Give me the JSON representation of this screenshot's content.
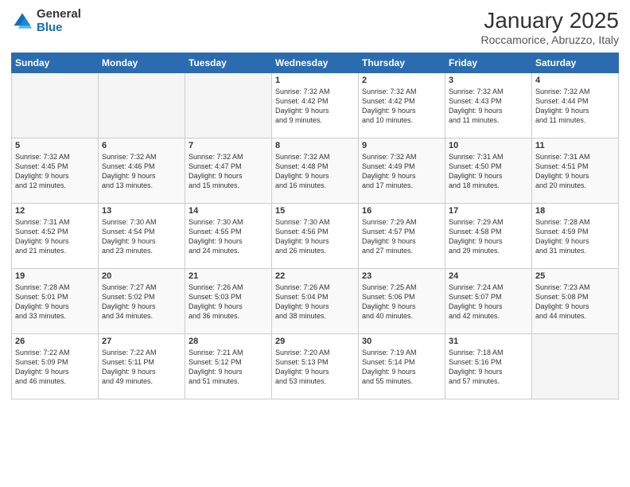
{
  "logo": {
    "general": "General",
    "blue": "Blue"
  },
  "title": "January 2025",
  "location": "Roccamorice, Abruzzo, Italy",
  "weekdays": [
    "Sunday",
    "Monday",
    "Tuesday",
    "Wednesday",
    "Thursday",
    "Friday",
    "Saturday"
  ],
  "weeks": [
    [
      {
        "day": "",
        "info": ""
      },
      {
        "day": "",
        "info": ""
      },
      {
        "day": "",
        "info": ""
      },
      {
        "day": "1",
        "info": "Sunrise: 7:32 AM\nSunset: 4:42 PM\nDaylight: 9 hours\nand 9 minutes."
      },
      {
        "day": "2",
        "info": "Sunrise: 7:32 AM\nSunset: 4:42 PM\nDaylight: 9 hours\nand 10 minutes."
      },
      {
        "day": "3",
        "info": "Sunrise: 7:32 AM\nSunset: 4:43 PM\nDaylight: 9 hours\nand 11 minutes."
      },
      {
        "day": "4",
        "info": "Sunrise: 7:32 AM\nSunset: 4:44 PM\nDaylight: 9 hours\nand 11 minutes."
      }
    ],
    [
      {
        "day": "5",
        "info": "Sunrise: 7:32 AM\nSunset: 4:45 PM\nDaylight: 9 hours\nand 12 minutes."
      },
      {
        "day": "6",
        "info": "Sunrise: 7:32 AM\nSunset: 4:46 PM\nDaylight: 9 hours\nand 13 minutes."
      },
      {
        "day": "7",
        "info": "Sunrise: 7:32 AM\nSunset: 4:47 PM\nDaylight: 9 hours\nand 15 minutes."
      },
      {
        "day": "8",
        "info": "Sunrise: 7:32 AM\nSunset: 4:48 PM\nDaylight: 9 hours\nand 16 minutes."
      },
      {
        "day": "9",
        "info": "Sunrise: 7:32 AM\nSunset: 4:49 PM\nDaylight: 9 hours\nand 17 minutes."
      },
      {
        "day": "10",
        "info": "Sunrise: 7:31 AM\nSunset: 4:50 PM\nDaylight: 9 hours\nand 18 minutes."
      },
      {
        "day": "11",
        "info": "Sunrise: 7:31 AM\nSunset: 4:51 PM\nDaylight: 9 hours\nand 20 minutes."
      }
    ],
    [
      {
        "day": "12",
        "info": "Sunrise: 7:31 AM\nSunset: 4:52 PM\nDaylight: 9 hours\nand 21 minutes."
      },
      {
        "day": "13",
        "info": "Sunrise: 7:30 AM\nSunset: 4:54 PM\nDaylight: 9 hours\nand 23 minutes."
      },
      {
        "day": "14",
        "info": "Sunrise: 7:30 AM\nSunset: 4:55 PM\nDaylight: 9 hours\nand 24 minutes."
      },
      {
        "day": "15",
        "info": "Sunrise: 7:30 AM\nSunset: 4:56 PM\nDaylight: 9 hours\nand 26 minutes."
      },
      {
        "day": "16",
        "info": "Sunrise: 7:29 AM\nSunset: 4:57 PM\nDaylight: 9 hours\nand 27 minutes."
      },
      {
        "day": "17",
        "info": "Sunrise: 7:29 AM\nSunset: 4:58 PM\nDaylight: 9 hours\nand 29 minutes."
      },
      {
        "day": "18",
        "info": "Sunrise: 7:28 AM\nSunset: 4:59 PM\nDaylight: 9 hours\nand 31 minutes."
      }
    ],
    [
      {
        "day": "19",
        "info": "Sunrise: 7:28 AM\nSunset: 5:01 PM\nDaylight: 9 hours\nand 33 minutes."
      },
      {
        "day": "20",
        "info": "Sunrise: 7:27 AM\nSunset: 5:02 PM\nDaylight: 9 hours\nand 34 minutes."
      },
      {
        "day": "21",
        "info": "Sunrise: 7:26 AM\nSunset: 5:03 PM\nDaylight: 9 hours\nand 36 minutes."
      },
      {
        "day": "22",
        "info": "Sunrise: 7:26 AM\nSunset: 5:04 PM\nDaylight: 9 hours\nand 38 minutes."
      },
      {
        "day": "23",
        "info": "Sunrise: 7:25 AM\nSunset: 5:06 PM\nDaylight: 9 hours\nand 40 minutes."
      },
      {
        "day": "24",
        "info": "Sunrise: 7:24 AM\nSunset: 5:07 PM\nDaylight: 9 hours\nand 42 minutes."
      },
      {
        "day": "25",
        "info": "Sunrise: 7:23 AM\nSunset: 5:08 PM\nDaylight: 9 hours\nand 44 minutes."
      }
    ],
    [
      {
        "day": "26",
        "info": "Sunrise: 7:22 AM\nSunset: 5:09 PM\nDaylight: 9 hours\nand 46 minutes."
      },
      {
        "day": "27",
        "info": "Sunrise: 7:22 AM\nSunset: 5:11 PM\nDaylight: 9 hours\nand 49 minutes."
      },
      {
        "day": "28",
        "info": "Sunrise: 7:21 AM\nSunset: 5:12 PM\nDaylight: 9 hours\nand 51 minutes."
      },
      {
        "day": "29",
        "info": "Sunrise: 7:20 AM\nSunset: 5:13 PM\nDaylight: 9 hours\nand 53 minutes."
      },
      {
        "day": "30",
        "info": "Sunrise: 7:19 AM\nSunset: 5:14 PM\nDaylight: 9 hours\nand 55 minutes."
      },
      {
        "day": "31",
        "info": "Sunrise: 7:18 AM\nSunset: 5:16 PM\nDaylight: 9 hours\nand 57 minutes."
      },
      {
        "day": "",
        "info": ""
      }
    ]
  ]
}
